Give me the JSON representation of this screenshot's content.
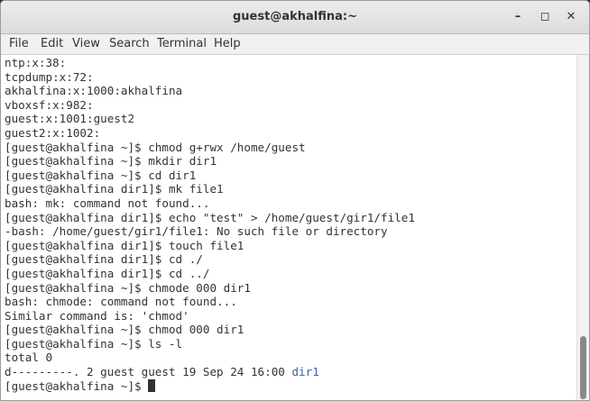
{
  "window": {
    "title": "guest@akhalfina:~",
    "controls": {
      "minimize": "–",
      "maximize": "◻",
      "close": "✕"
    }
  },
  "menu": {
    "items": [
      "File",
      "Edit",
      "View",
      "Search",
      "Terminal",
      "Help"
    ]
  },
  "terminal": {
    "lines": [
      "ntp:x:38:",
      "tcpdump:x:72:",
      "akhalfina:x:1000:akhalfina",
      "vboxsf:x:982:",
      "guest:x:1001:guest2",
      "guest2:x:1002:",
      "[guest@akhalfina ~]$ chmod g+rwx /home/guest",
      "[guest@akhalfina ~]$ mkdir dir1",
      "[guest@akhalfina ~]$ cd dir1",
      "[guest@akhalfina dir1]$ mk file1",
      "bash: mk: command not found...",
      "[guest@akhalfina dir1]$ echo \"test\" > /home/guest/gir1/file1",
      "-bash: /home/guest/gir1/file1: No such file or directory",
      "[guest@akhalfina dir1]$ touch file1",
      "[guest@akhalfina dir1]$ cd ./",
      "[guest@akhalfina dir1]$ cd ../",
      "[guest@akhalfina ~]$ chmode 000 dir1",
      "bash: chmode: command not found...",
      "Similar command is: 'chmod'",
      "[guest@akhalfina ~]$ chmod 000 dir1",
      "[guest@akhalfina ~]$ ls -l",
      "total 0"
    ],
    "ls_line_prefix": "d---------. 2 guest guest 19 Sep 24 16:00 ",
    "ls_line_dir": "dir1",
    "prompt_line": "[guest@akhalfina ~]$ "
  },
  "colors": {
    "text": "#2e3436",
    "directory": "#3465a4",
    "background": "#ffffff"
  }
}
